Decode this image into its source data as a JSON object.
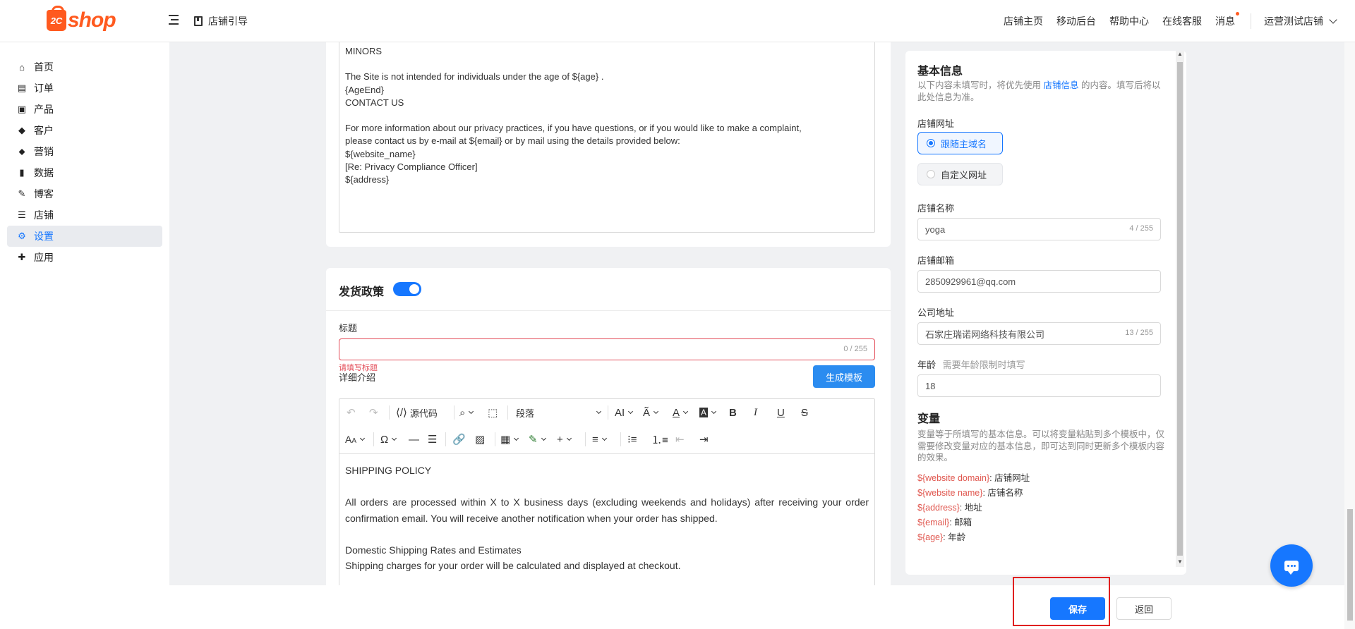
{
  "header": {
    "logo_prefix": "2C",
    "logo_text": "shop",
    "guide_label": "店铺引导",
    "nav": [
      "店铺主页",
      "移动后台",
      "帮助中心",
      "在线客服",
      "消息"
    ],
    "store_name": "运营测试店铺"
  },
  "sidebar": {
    "items": [
      {
        "label": "首页",
        "icon": "home-icon",
        "glyph": "⌂"
      },
      {
        "label": "订单",
        "icon": "order-icon",
        "glyph": "▤"
      },
      {
        "label": "产品",
        "icon": "product-bag-icon",
        "glyph": "▣"
      },
      {
        "label": "客户",
        "icon": "customer-diamond-icon",
        "glyph": "◆"
      },
      {
        "label": "营销",
        "icon": "tag-icon",
        "glyph": "⬥"
      },
      {
        "label": "数据",
        "icon": "bar-chart-icon",
        "glyph": "▮"
      },
      {
        "label": "博客",
        "icon": "edit-icon",
        "glyph": "✎"
      },
      {
        "label": "店铺",
        "icon": "store-icon",
        "glyph": "☰"
      },
      {
        "label": "设置",
        "icon": "gear-icon",
        "glyph": "⚙"
      },
      {
        "label": "应用",
        "icon": "puzzle-icon",
        "glyph": "✚"
      }
    ],
    "active_index": 8
  },
  "privacy_text": {
    "lines": [
      "MINORS",
      "",
      "The Site is not intended for individuals under the age of ${age} .",
      "{AgeEnd}",
      "CONTACT US",
      "",
      "For more information about our privacy practices, if you have questions, or if you would like to make a complaint,",
      "please contact us by e-mail at ${email} or by mail using the details provided below:",
      "${website_name}",
      "[Re: Privacy Compliance Officer]",
      "${address}"
    ]
  },
  "shipping": {
    "section_title": "发货政策",
    "enabled": true,
    "title_label": "标题",
    "title_value": "",
    "title_counter": "0 / 255",
    "title_error": "请填写标题",
    "detail_label": "详细介绍",
    "generate_button": "生成模板",
    "toolbar": {
      "source_label": "源代码",
      "paragraph_label": "段落"
    },
    "editor_paragraphs": [
      "SHIPPING POLICY",
      "",
      "All orders are processed within X to X business days (excluding weekends and holidays) after receiving your order confirmation email. You will receive another notification when your order has shipped.",
      "",
      "Domestic Shipping Rates and Estimates",
      "Shipping charges for your order will be calculated and displayed at checkout."
    ]
  },
  "basic_info": {
    "title": "基本信息",
    "desc_before": "以下内容未填写时，将优先使用 ",
    "desc_link": "店铺信息",
    "desc_after": " 的内容。填写后将以此处信息为准。",
    "url_label": "店铺网址",
    "url_options": [
      "跟随主域名",
      "自定义网址"
    ],
    "url_selected": 0,
    "name_label": "店铺名称",
    "name_value": "yoga",
    "name_counter": "4 / 255",
    "email_label": "店铺邮箱",
    "email_value": "2850929961@qq.com",
    "address_label": "公司地址",
    "address_value": "石家庄瑞诺网络科技有限公司",
    "address_counter": "13 / 255",
    "age_label": "年龄",
    "age_hint": "需要年龄限制时填写",
    "age_value": "18"
  },
  "variables": {
    "title": "变量",
    "desc": "变量等于所填写的基本信息。可以将变量粘贴到多个模板中，仅需要修改变量对应的基本信息，即可达到同时更新多个模板内容的效果。",
    "items": [
      {
        "var": "${website domain}",
        "meaning": "店铺网址"
      },
      {
        "var": "${website name}",
        "meaning": "店铺名称"
      },
      {
        "var": "${address}",
        "meaning": "地址"
      },
      {
        "var": "${email}",
        "meaning": "邮箱"
      },
      {
        "var": "${age}",
        "meaning": "年龄"
      }
    ]
  },
  "footer": {
    "save_label": "保存",
    "back_label": "返回"
  },
  "colors": {
    "primary": "#1677ff",
    "brand": "#ff5a1f",
    "error": "#e34d59",
    "variable": "#e0574f",
    "highlight_box": "#e02020"
  }
}
